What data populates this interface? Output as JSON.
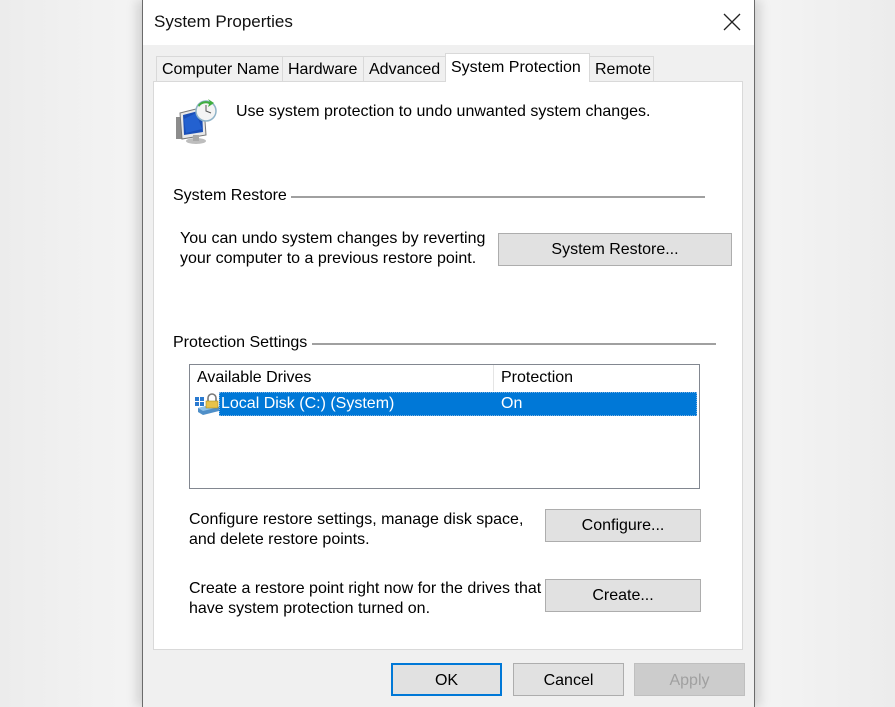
{
  "window": {
    "title": "System Properties",
    "close_icon": "close-icon"
  },
  "tabs": [
    {
      "label": "Computer Name",
      "active": false
    },
    {
      "label": "Hardware",
      "active": false
    },
    {
      "label": "Advanced",
      "active": false
    },
    {
      "label": "System Protection",
      "active": true
    },
    {
      "label": "Remote",
      "active": false
    }
  ],
  "intro": {
    "icon": "system-protection-icon",
    "text": "Use system protection to undo unwanted system changes."
  },
  "system_restore": {
    "group_label": "System Restore",
    "description_line1": "You can undo system changes by reverting",
    "description_line2": "your computer to a previous restore point.",
    "button_label": "System Restore..."
  },
  "protection_settings": {
    "group_label": "Protection Settings",
    "columns": [
      "Available Drives",
      "Protection"
    ],
    "drives": [
      {
        "icon": "drive-protected-icon",
        "name": "Local Disk (C:) (System)",
        "protection": "On",
        "selected": true
      }
    ],
    "configure": {
      "description_line1": "Configure restore settings, manage disk space,",
      "description_line2": "and delete restore points.",
      "button_label": "Configure..."
    },
    "create": {
      "description_line1": "Create a restore point right now for the drives that",
      "description_line2": "have system protection turned on.",
      "button_label": "Create..."
    }
  },
  "footer": {
    "ok_label": "OK",
    "cancel_label": "Cancel",
    "apply_label": "Apply",
    "apply_disabled": true
  },
  "colors": {
    "selection": "#0078d7",
    "default_button_border": "#0078d7",
    "button_face": "#e1e1e1",
    "window_body": "#f0f0f0"
  }
}
